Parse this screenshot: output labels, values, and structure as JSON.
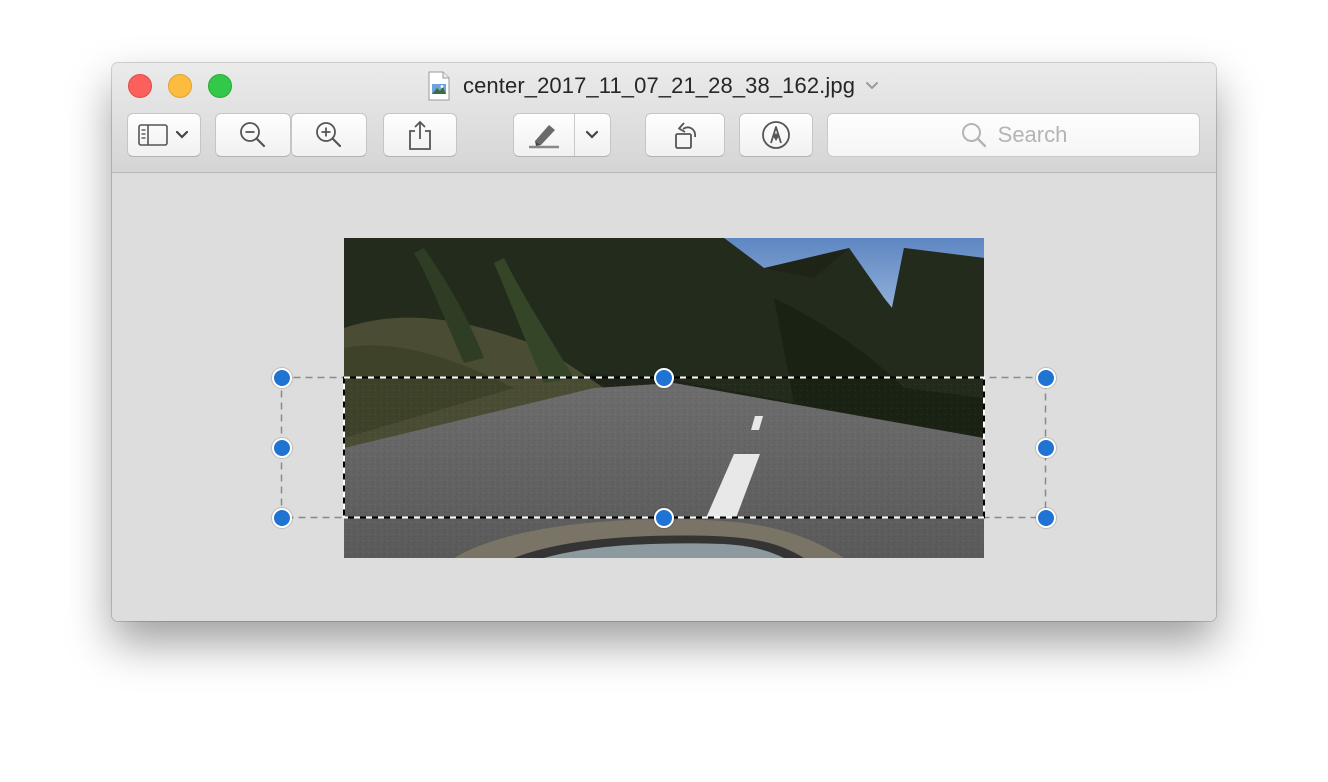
{
  "window": {
    "title": "center_2017_11_07_21_28_38_162.jpg"
  },
  "toolbar": {
    "buttons": [
      {
        "name": "sidebar-view-button",
        "icon": "sidebar-icon"
      },
      {
        "name": "zoom-out-button",
        "icon": "zoom-out-icon"
      },
      {
        "name": "zoom-in-button",
        "icon": "zoom-in-icon"
      },
      {
        "name": "share-button",
        "icon": "share-icon"
      },
      {
        "name": "markup-highlight-button",
        "icon": "highlighter-icon"
      },
      {
        "name": "rotate-button",
        "icon": "rotate-left-icon"
      },
      {
        "name": "markup-toolbar-button",
        "icon": "pen-circle-icon"
      }
    ],
    "search": {
      "placeholder": "Search"
    }
  },
  "image": {
    "description_icon": "road-camera-image"
  },
  "colors": {
    "close": "#fc605c",
    "minimize": "#fdbc40",
    "maximize": "#34c84a",
    "selection_handle": "#1f73d3"
  }
}
